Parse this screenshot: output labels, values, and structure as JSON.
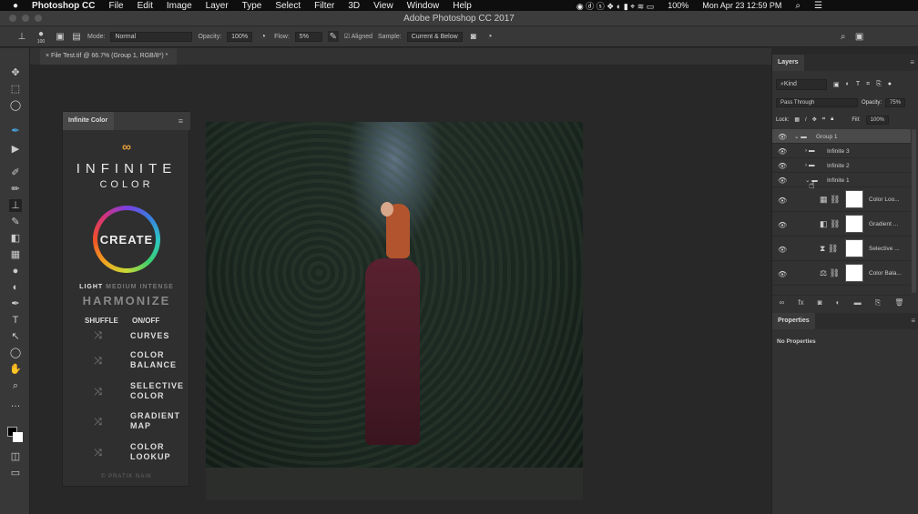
{
  "menubar": {
    "apple": "",
    "app": "Photoshop CC",
    "items": [
      "File",
      "Edit",
      "Image",
      "Layer",
      "Type",
      "Select",
      "Filter",
      "3D",
      "View",
      "Window",
      "Help"
    ],
    "battery": "100%",
    "datetime": "Mon Apr 23  12:59 PM"
  },
  "window": {
    "title": "Adobe Photoshop CC 2017"
  },
  "options": {
    "brush_size": "100",
    "mode_label": "Mode:",
    "mode": "Normal",
    "opacity_label": "Opacity:",
    "opacity": "100%",
    "flow_label": "Flow:",
    "flow": "5%",
    "aligned": "Aligned",
    "sample_label": "Sample:",
    "sample": "Current & Below"
  },
  "document": {
    "tab": "File Test.tif @ 66.7% (Group 1, RGB/8*) *"
  },
  "infinite_color": {
    "tab": "Infinite Color",
    "logo1": "INFINITE",
    "logo2": "COLOR",
    "create": "CREATE",
    "light": "LIGHT",
    "medium": "MEDIUM",
    "intense": "INTENSE",
    "harmonize": "HARMONIZE",
    "shuffle": "SHUFFLE",
    "onoff": "ON/OFF",
    "adjustments": [
      [
        "CURVES"
      ],
      [
        "COLOR",
        "BALANCE"
      ],
      [
        "SELECTIVE",
        "COLOR"
      ],
      [
        "GRADIENT",
        "MAP"
      ],
      [
        "COLOR",
        "LOOKUP"
      ]
    ],
    "footer": "© PRATIK NAIK"
  },
  "layers": {
    "tab": "Layers",
    "kind": "Kind",
    "blend": "Pass Through",
    "opacity_label": "Opacity:",
    "opacity": "75%",
    "lock_label": "Lock:",
    "fill_label": "Fill:",
    "fill": "100%",
    "items": [
      {
        "name": "Group 1",
        "type": "group"
      },
      {
        "name": "Infinite 3",
        "type": "group"
      },
      {
        "name": "Infinite 2",
        "type": "group"
      },
      {
        "name": "Infinite 1",
        "type": "group"
      },
      {
        "name": "Color Loo...",
        "type": "adjust"
      },
      {
        "name": "Gradient ...",
        "type": "adjust"
      },
      {
        "name": "Selective ...",
        "type": "adjust"
      },
      {
        "name": "Color Bala...",
        "type": "adjust"
      }
    ]
  },
  "properties": {
    "tab": "Properties",
    "status": "No Properties"
  }
}
